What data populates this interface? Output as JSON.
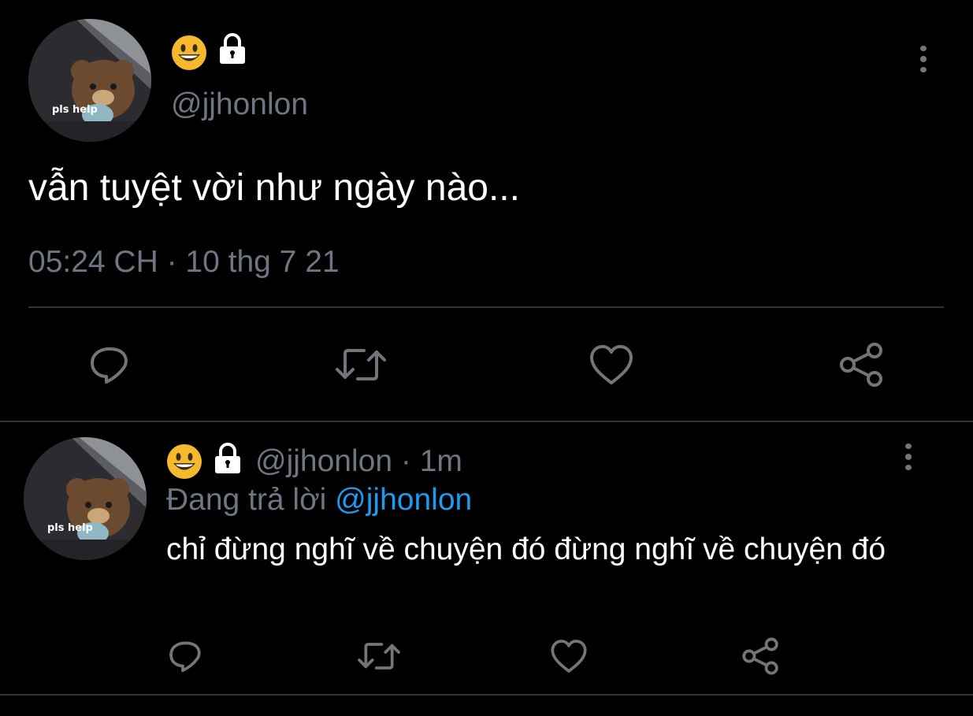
{
  "main_tweet": {
    "avatar_text": "pls help",
    "display_icons": [
      "grinning-face-emoji",
      "lock-icon"
    ],
    "handle": "@jjhonlon",
    "text": "vẫn tuyệt vời như ngày nào...",
    "timestamp": "05:24 CH · 10 thg 7 21",
    "actions": [
      "reply-icon",
      "retweet-icon",
      "like-icon",
      "share-icon"
    ]
  },
  "reply_tweet": {
    "avatar_text": "pls help",
    "display_icons": [
      "grinning-face-emoji",
      "lock-icon"
    ],
    "handle_time": "@jjhonlon · 1m",
    "replying_prefix": "Đang trả lời",
    "replying_handle": "@jjhonlon",
    "text": "chỉ đừng nghĩ về chuyện đó đừng nghĩ về chuyện đó",
    "actions": [
      "reply-icon",
      "retweet-icon",
      "like-icon",
      "share-icon"
    ]
  },
  "colors": {
    "background": "#000000",
    "muted": "#6e7681",
    "link": "#1d9bf0",
    "divider": "#2f3336"
  }
}
